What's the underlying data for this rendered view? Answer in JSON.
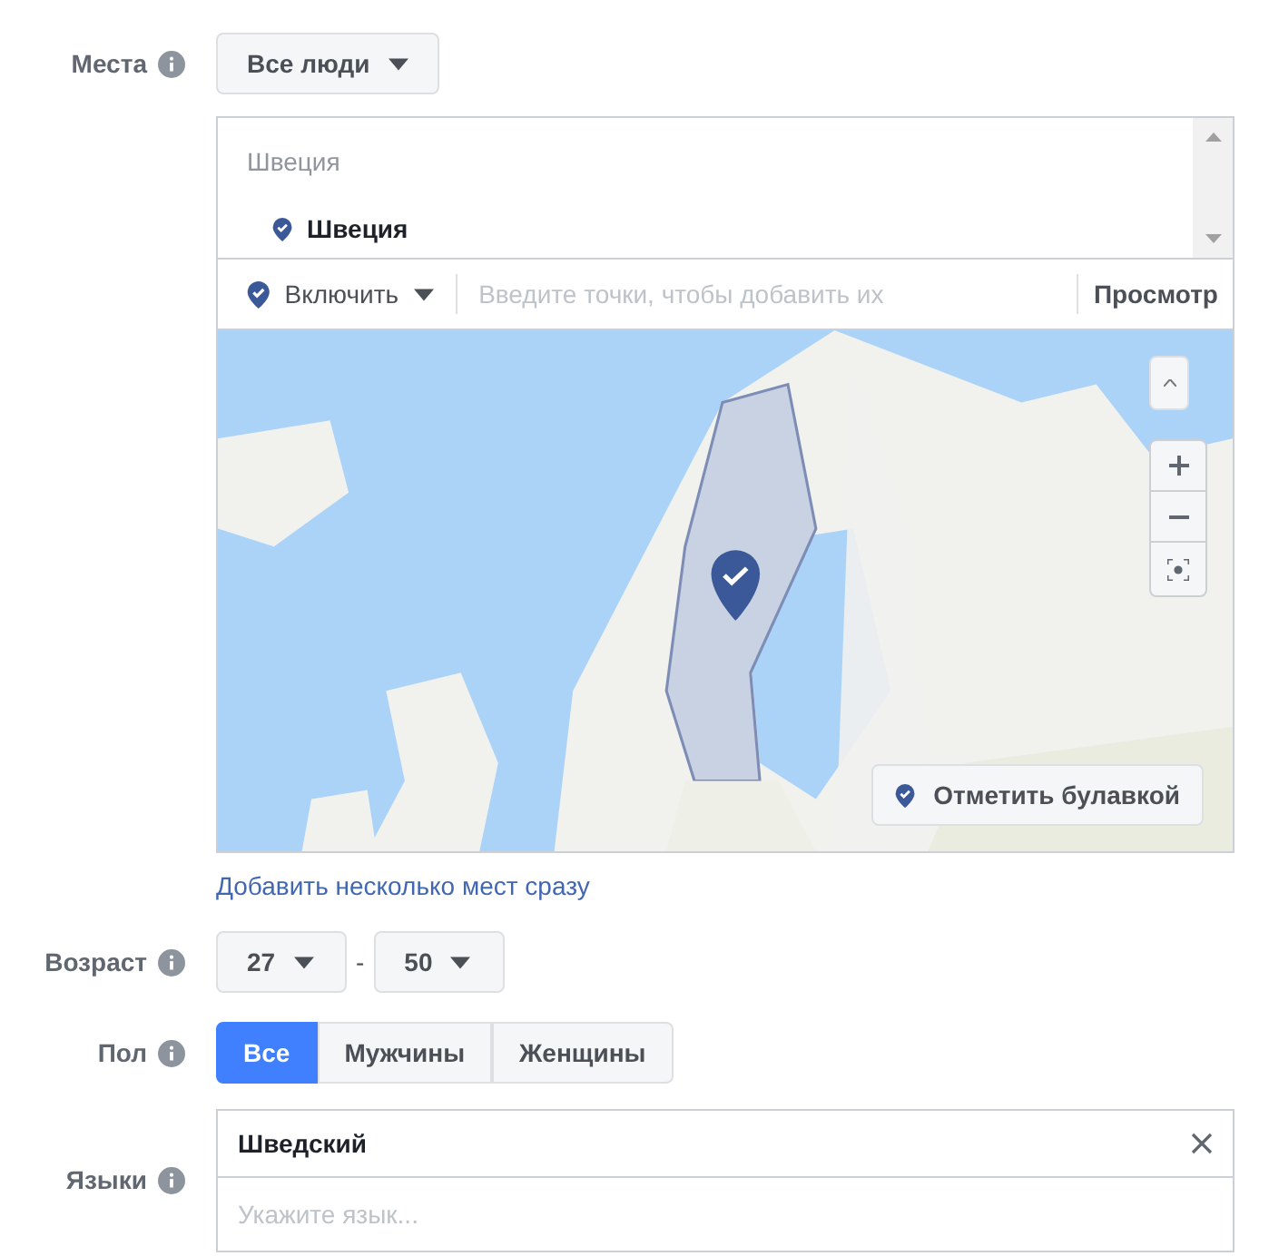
{
  "places": {
    "label": "Места",
    "audience": "Все люди",
    "group": "Швеция",
    "locations": [
      {
        "name": "Швеция"
      }
    ],
    "mode": "Включить",
    "search_placeholder": "Введите точки, чтобы добавить их",
    "browse": "Просмотр",
    "drop_pin": "Отметить булавкой",
    "bulk_link": "Добавить несколько мест сразу"
  },
  "age": {
    "label": "Возраст",
    "min": "27",
    "separator": "-",
    "max": "50"
  },
  "gender": {
    "label": "Пол",
    "options": [
      {
        "label": "Все",
        "selected": true
      },
      {
        "label": "Мужчины",
        "selected": false
      },
      {
        "label": "Женщины",
        "selected": false
      }
    ]
  },
  "languages": {
    "label": "Языки",
    "items": [
      "Шведский"
    ],
    "placeholder": "Укажите язык..."
  }
}
